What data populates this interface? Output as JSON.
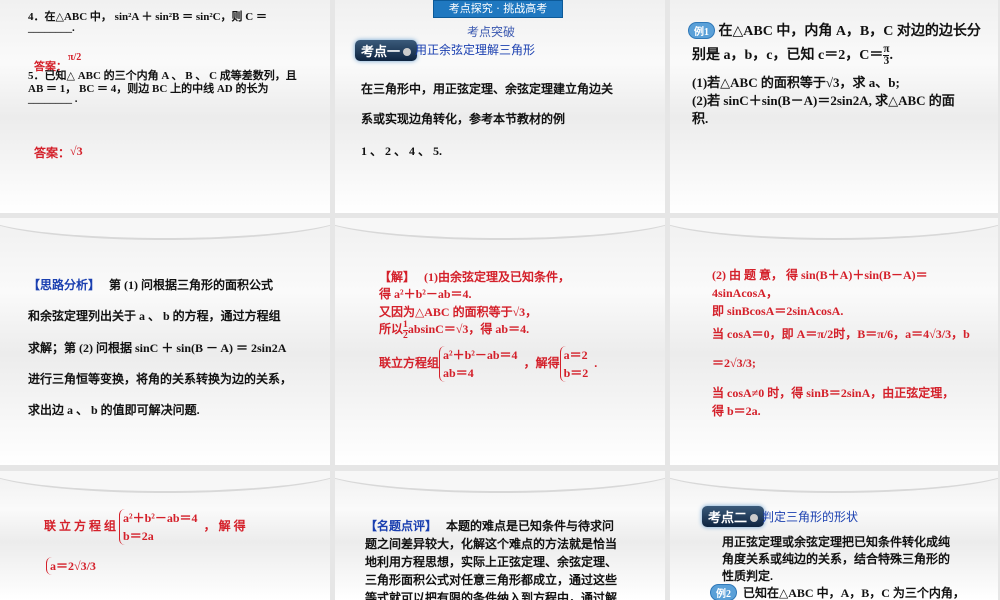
{
  "s1": {
    "q4": "4．在△ABC 中， sin²A ＋ sin²B ＝ sin²C，则 C ＝",
    "blank": "________.",
    "ans_label": "答案：",
    "ans1": "π/2",
    "q5a": "5．已知△ ABC 的三个内角 A 、 B 、 C 成等差数列，且",
    "q5b": "AB ＝ 1， BC ＝ 4，则边 BC 上的中线 AD 的长为",
    "blank2": "________ .",
    "ans2": "√3"
  },
  "s2": {
    "header": "考点探究 · 挑战高考",
    "sub": "考点突破",
    "badge": "考点一",
    "title": "用正余弦定理解三角形",
    "l1": "在三角形中，用正弦定理、余弦定理建立角边关",
    "l2": "系或实现边角转化，参考本节教材的例",
    "l3": "1 、 2 、 4 、 5."
  },
  "s3": {
    "badge": "例1",
    "l1": "在△ABC 中，内角 A，B，C 对边的边长分",
    "l2": "别是 a，b，c，已知 c＝2，C＝",
    "num": "π",
    "den": "3",
    "l3": "(1)若△ABC 的面积等于√3，求 a、b;",
    "l4": "(2)若 sinC＋sin(B－A)＝2sin2A, 求△ABC 的面",
    "l5": "积."
  },
  "s4": {
    "label": "【思路分析】",
    "l1": "第 (1) 问根据三角形的面积公式",
    "l2": "和余弦定理列出关于 a 、 b 的方程，通过方程组",
    "l3": "求解；第 (2) 问根据 sinC ＋ sin(B － A) ＝ 2sin2A",
    "l4": "进行三角恒等变换，将角的关系转换为边的关系，",
    "l5": "求出边 a 、 b 的值即可解决问题."
  },
  "s5": {
    "label": "【解】",
    "l1": "(1)由余弦定理及已知条件，",
    "l2": "得 a²＋b²－ab＝4.",
    "l3": "又因为△ABC 的面积等于√3，",
    "l4a": "所以",
    "half_n": "1",
    "half_d": "2",
    "l4b": "absinC＝√3，得 ab＝4.",
    "l5": "联立方程组",
    "e1": "a²＋b²－ab＝4",
    "e2": "ab＝4",
    "l5b": "，解得",
    "r1": "a＝2",
    "r2": "b＝2",
    "end": "."
  },
  "s6": {
    "l1": "(2) 由 题 意， 得  sin(B＋A)＋sin(B－A)＝",
    "l2": "4sinAcosA，",
    "l3": "即 sinBcosA＝2sinAcosA.",
    "l4": "当 cosA＝0，即 A＝π/2时，B＝π/6，a＝4√3/3，b",
    "l5": "＝2√3/3;",
    "l6": "当 cosA≠0 时，得 sinB＝2sinA，由正弦定理，",
    "l7": "得 b＝2a."
  },
  "s7": {
    "l1": "联 立 方 程 组",
    "e1": "a²＋b²－ab＝4",
    "e2": "b＝2a",
    "l1b": "，  解  得",
    "r1": "a＝2√3/3"
  },
  "s8": {
    "label": "【名题点评】",
    "l1": "本题的难点是已知条件与待求问",
    "l2": "题之间差异较大，化解这个难点的方法就是恰当",
    "l3": "地利用方程思想，实际上正弦定理、余弦定理、",
    "l4": "三角形面积公式对任意三角形都成立，通过这些",
    "l5": "等式就可以把有限的条件纳入到方程中，通过解"
  },
  "s9": {
    "badge": "考点二",
    "title": "判定三角形的形状",
    "l1": "用正弦定理或余弦定理把已知条件转化成纯",
    "l2": "角度关系或纯边的关系，结合特殊三角形的",
    "l3": "性质判定.",
    "ex": "例2",
    "l4": "已知在△ABC 中，A，B，C 为三个内角，"
  }
}
